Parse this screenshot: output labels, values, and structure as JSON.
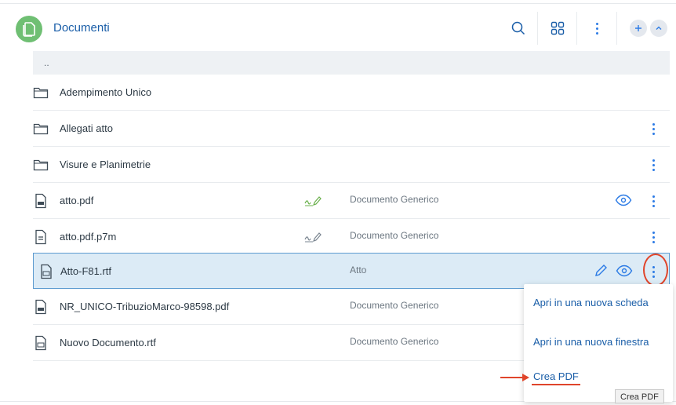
{
  "header": {
    "title": "Documenti",
    "icons": [
      "document-app-icon",
      "search-icon",
      "grid-view-icon",
      "more-vertical-icon",
      "plus-icon",
      "chevron-up-icon"
    ]
  },
  "list": {
    "parent_label": "..",
    "rows": [
      {
        "name": "Adempimento Unico",
        "kind": "folder",
        "type": "",
        "has_menu": false
      },
      {
        "name": "Allegati atto",
        "kind": "folder",
        "type": "",
        "has_menu": true
      },
      {
        "name": "Visure e Planimetrie",
        "kind": "folder",
        "type": "",
        "has_menu": true
      },
      {
        "name": "atto.pdf",
        "kind": "pdf",
        "type": "Documento Generico",
        "signed": true,
        "has_menu": true
      },
      {
        "name": "atto.pdf.p7m",
        "kind": "p7m",
        "type": "Documento Generico",
        "signed": true,
        "has_menu": true
      },
      {
        "name": "Atto-F81.rtf",
        "kind": "rtf",
        "type": "Atto",
        "selected": true,
        "has_menu": true
      },
      {
        "name": "NR_UNICO-TribuzioMarco-98598.pdf",
        "kind": "pdf",
        "type": "Documento Generico",
        "has_menu": false
      },
      {
        "name": "Nuovo Documento.rtf",
        "kind": "rtf",
        "type": "Documento Generico",
        "has_menu": false
      }
    ]
  },
  "context_menu": {
    "items": [
      "Apri in una nuova scheda",
      "Apri in una nuova finestra",
      "Crea PDF"
    ]
  },
  "tooltip": "Crea PDF",
  "colors": {
    "accent": "#1a5ea8",
    "app_icon": "#6fbf73",
    "selection": "#dcebf6",
    "annotation": "#e0452b"
  }
}
